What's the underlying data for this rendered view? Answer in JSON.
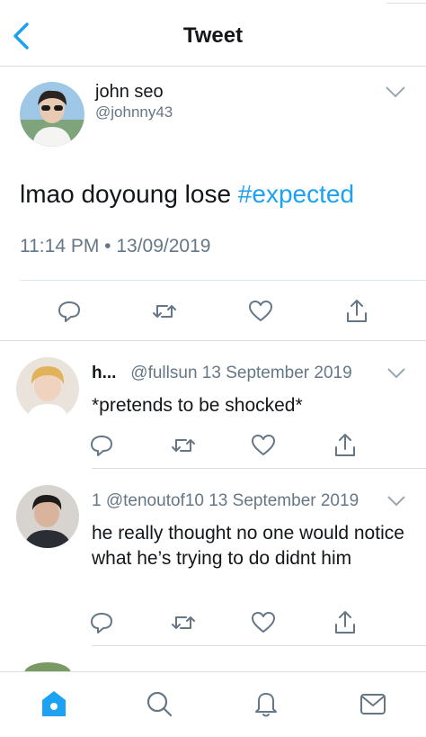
{
  "header": {
    "title": "Tweet",
    "back_icon": "chevron-left-icon"
  },
  "colors": {
    "accent": "#1da1f2",
    "secondary_text": "#657786",
    "divider": "#e1e8ed"
  },
  "tweet": {
    "author_name": "john seo",
    "author_handle": "@johnny43",
    "text": "lmao doyoung lose ",
    "hashtag": "#expected",
    "timestamp": "11:14 PM • 13/09/2019",
    "actions": [
      "reply-icon",
      "retweet-icon",
      "like-icon",
      "share-icon"
    ]
  },
  "replies": [
    {
      "name": "h...",
      "handle_date": "@fullsun 13 September 2019",
      "text": "*pretends to be shocked*"
    },
    {
      "name": "1",
      "handle_date": "@tenoutof10 13 September 2019",
      "text": "he really thought no one would notice what he’s trying to do didnt him"
    }
  ],
  "tabbar": {
    "tabs": [
      "home-icon",
      "search-icon",
      "notifications-icon",
      "messages-icon"
    ],
    "active": "home-icon"
  }
}
